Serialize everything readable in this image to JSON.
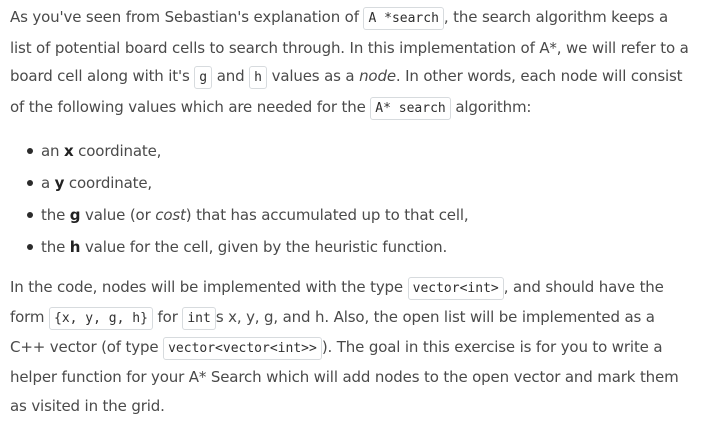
{
  "para1": {
    "t1": "As you've seen from Sebastian's explanation of ",
    "c1": "A *search",
    "t2": ", the search algorithm keeps a list of potential board cells to search through. In this implementation of A*, we will refer to a board cell along with it's ",
    "c2": "g",
    "t3": " and ",
    "c3": "h",
    "t4": " values as a ",
    "em1": "node",
    "t5": ". In other words, each node will consist of the following values which are needed for the ",
    "c4": "A* search",
    "t6": " algorithm:"
  },
  "bullets": [
    {
      "pre": "an ",
      "bold": "x",
      "post": " coordinate,"
    },
    {
      "pre": "a ",
      "bold": "y",
      "post": " coordinate,"
    },
    {
      "pre": "the ",
      "bold": "g",
      "mid": " value (or ",
      "em": "cost",
      "post": ") that has accumulated up to that cell,"
    },
    {
      "pre": "the ",
      "bold": "h",
      "post": " value for the cell, given by the heuristic function."
    }
  ],
  "para2": {
    "t1": "In the code, nodes will be implemented with the type ",
    "c1": "vector<int>",
    "t2": ", and should have the form ",
    "c2": "{x, y, g, h}",
    "t3": " for ",
    "c3": "int",
    "t4": "s x, y, g, and h. Also, the open list will be implemented as a C++ vector (of type ",
    "c4": "vector<vector<int>>",
    "t5": "). The goal in this exercise is for you to write a helper function for your A* Search which will add nodes to the open vector and mark them as visited in the grid."
  }
}
